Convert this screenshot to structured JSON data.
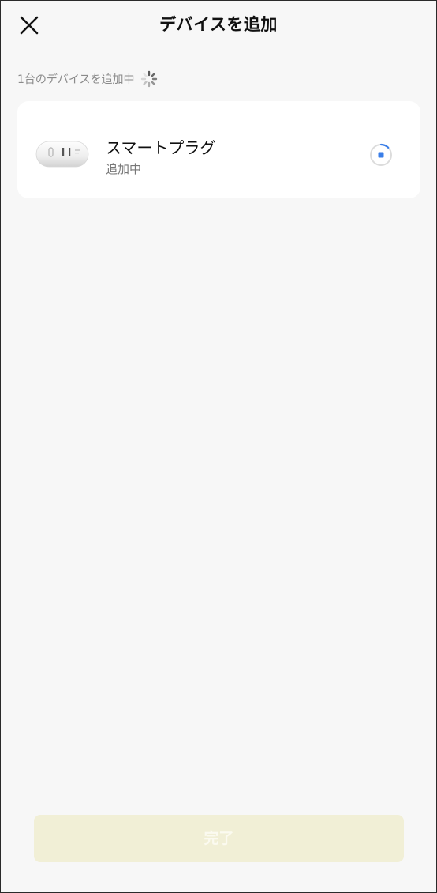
{
  "header": {
    "title": "デバイスを追加",
    "close_icon": "close-icon"
  },
  "status": {
    "text": "1台のデバイスを追加中",
    "icon": "spinner-icon"
  },
  "device": {
    "name": "スマートプラグ",
    "status": "追加中",
    "image": "smart-plug-image",
    "progress_icon": "progress-icon"
  },
  "footer": {
    "done_label": "完了"
  },
  "colors": {
    "background": "#f7f7f7",
    "card": "#ffffff",
    "accent": "#3a7ee8",
    "button_disabled": "#f1efd6"
  }
}
